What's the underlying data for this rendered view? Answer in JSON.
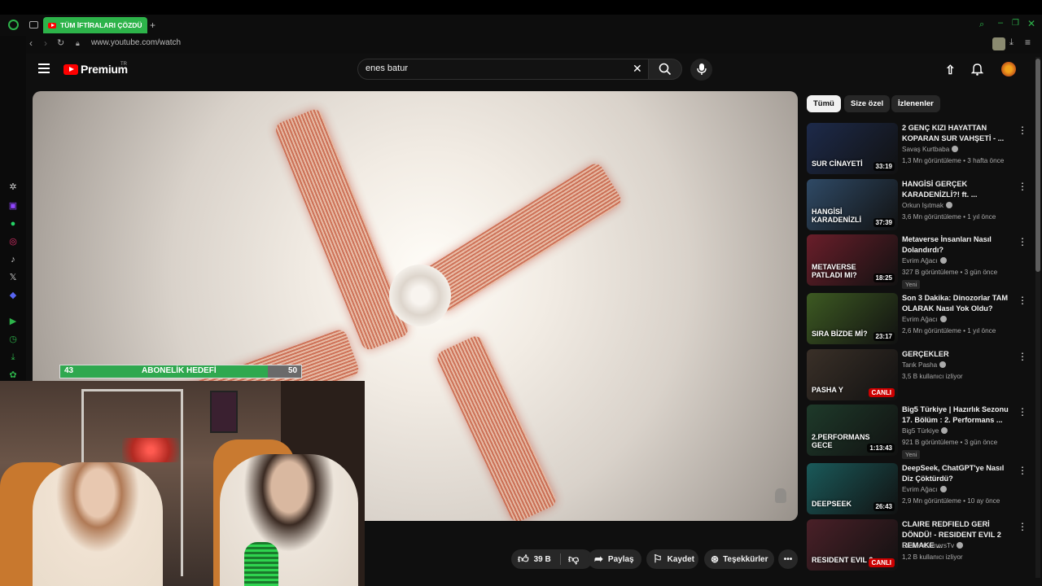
{
  "browser": {
    "tab_title": "TÜM İFTİRALARI ÇÖZDÜ",
    "url": "www.youtube.com/watch",
    "new_tab": "+"
  },
  "youtube": {
    "logo_text": "Premium",
    "logo_region": "TR",
    "search_value": "enes batur"
  },
  "goal": {
    "current": "43",
    "label": "ABONELİK HEDEFİ",
    "target": "50",
    "progress_fraction": 0.86
  },
  "actions": {
    "likes": "39 B",
    "share": "Paylaş",
    "save": "Kaydet",
    "thanks": "Teşekkürler"
  },
  "chips": [
    "Tümü",
    "Size özel",
    "İzlenenler"
  ],
  "recommendations": [
    {
      "title": "2 GENÇ KIZI HAYATTAN KOPARAN SUR VAHŞETİ - ...",
      "channel": "Savaş Kurtbaba",
      "meta": "1,3 Mn görüntüleme • 3 hafta önce",
      "duration": "33:19",
      "badge": "",
      "thumb_text": "SUR CİNAYETİ",
      "color": "#1d2a4a"
    },
    {
      "title": "HANGİSİ GERÇEK KARADENİZLİ?! ft. ...",
      "channel": "Orkun Işıtmak",
      "meta": "3,6 Mn görüntüleme • 1 yıl önce",
      "duration": "37:39",
      "badge": "",
      "thumb_text": "HANGİSİ KARADENİZLİ",
      "color": "#2f4a66"
    },
    {
      "title": "Metaverse İnsanları Nasıl Dolandırdı?",
      "channel": "Evrim Ağacı",
      "meta": "327 B görüntüleme • 3 gün önce",
      "duration": "18:25",
      "badge": "Yeni",
      "thumb_text": "METAVERSE PATLADI MI?",
      "color": "#6a1e2a"
    },
    {
      "title": "Son 3 Dakika: Dinozorlar TAM OLARAK Nasıl Yok Oldu?",
      "channel": "Evrim Ağacı",
      "meta": "2,6 Mn görüntüleme • 1 yıl önce",
      "duration": "23:17",
      "badge": "",
      "thumb_text": "SIRA BİZDE Mİ?",
      "color": "#3d5a22"
    },
    {
      "title": "GERÇEKLER",
      "channel": "Tarık Pasha",
      "meta": "3,5 B kullanıcı izliyor",
      "duration": "",
      "live": "CANLI",
      "badge": "",
      "thumb_text": "PASHA Y",
      "color": "#3a3028"
    },
    {
      "title": "Big5 Türkiye | Hazırlık Sezonu 17. Bölüm : 2. Performans ...",
      "channel": "Big5 Türkiye",
      "meta": "921 B görüntüleme • 3 gün önce",
      "duration": "1:13:43",
      "badge": "Yeni",
      "thumb_text": "2.PERFORMANS GECE",
      "color": "#1e3a2a"
    },
    {
      "title": "DeepSeek, ChatGPT'ye Nasıl Diz Çöktürdü?",
      "channel": "Evrim Ağacı",
      "meta": "2,9 Mn görüntüleme • 10 ay önce",
      "duration": "26:43",
      "badge": "",
      "thumb_text": "DEEPSEEK",
      "color": "#1a5a5a"
    },
    {
      "title": "CLAIRE REDFIELD GERİ DÖNDÜ! - RESIDENT EVIL 2 REMAKE ...",
      "channel": "Easter GamersTv",
      "meta": "1,2 B kullanıcı izliyor",
      "duration": "",
      "live": "CANLI",
      "badge": "",
      "thumb_text": "RESIDENT EVIL 2",
      "color": "#4a2028"
    }
  ]
}
